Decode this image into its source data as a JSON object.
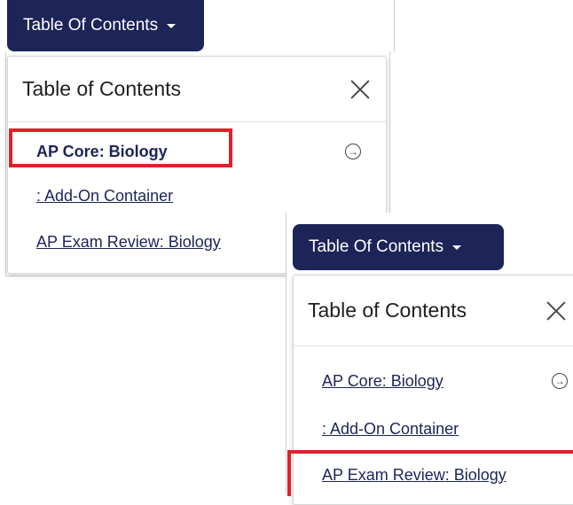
{
  "panels": [
    {
      "toc_button": {
        "label": "Table Of Contents"
      },
      "header": {
        "title": "Table of Contents"
      },
      "items": [
        {
          "label": "AP Core: Biology"
        },
        {
          "label": ": Add-On Container"
        },
        {
          "label": "AP Exam Review: Biology"
        }
      ],
      "highlighted_item": "AP Core: Biology"
    },
    {
      "toc_button": {
        "label": "Table Of Contents"
      },
      "header": {
        "title": "Table of Contents"
      },
      "items": [
        {
          "label": "AP Core: Biology"
        },
        {
          "label": ": Add-On Container"
        },
        {
          "label": "AP Exam Review: Biology"
        }
      ],
      "highlighted_item": "AP Exam Review: Biology"
    }
  ],
  "colors": {
    "button_bg": "#1c2458",
    "link": "#1c2458",
    "highlight": "#e0202a"
  },
  "icons": {
    "caret": "caret-down-icon",
    "close": "close-icon",
    "arrow": "arrow-right-circle-icon"
  }
}
